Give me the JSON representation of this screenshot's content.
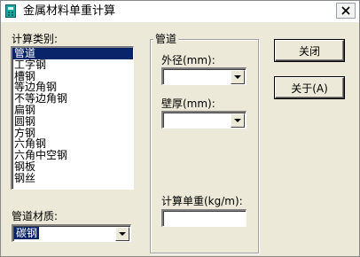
{
  "window": {
    "title": "金属材料单重计算",
    "close_symbol": "×"
  },
  "category": {
    "label": "计算类别:",
    "items": [
      "管道",
      "工字钢",
      "槽钢",
      "等边角钢",
      "不等边角钢",
      "扁钢",
      "圆钢",
      "方钢",
      "六角钢",
      "六角中空钢",
      "钢板",
      "钢丝"
    ],
    "selected": "管道"
  },
  "material": {
    "label": "管道材质:",
    "value": "碳钢"
  },
  "params_group": {
    "title": "管道",
    "outer_diameter_label": "外径(mm):",
    "outer_diameter_value": "",
    "wall_thickness_label": "壁厚(mm):",
    "wall_thickness_value": "",
    "unit_weight_label": "计算单重(kg/m):",
    "unit_weight_value": ""
  },
  "buttons": {
    "close_label": "关闭",
    "about_label": "关于(A)"
  },
  "colors": {
    "window_bg": "#ece9d8",
    "selection": "#0a246a",
    "icon": "#1aa8a0"
  }
}
